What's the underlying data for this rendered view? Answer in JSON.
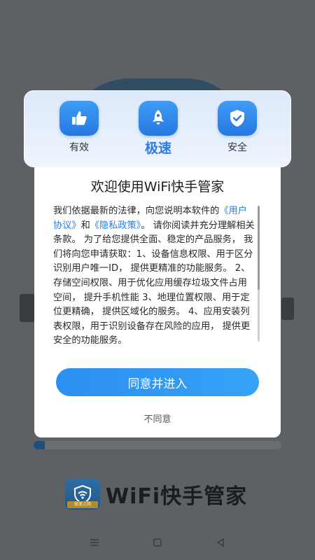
{
  "features": [
    {
      "label": "有效",
      "icon": "thumbs-up-icon"
    },
    {
      "label": "极速",
      "icon": "rocket-icon"
    },
    {
      "label": "安全",
      "icon": "shield-check-icon"
    }
  ],
  "dialog": {
    "title": "欢迎使用WiFi快手管家",
    "intro": "我们依据最新的法律，向您说明本软件的",
    "user_agreement": "《用户协议》",
    "and": "和",
    "privacy_policy": "《隐私政策》",
    "body": "。 请你阅读并充分理解相关条款。 为了给您提供全面、稳定的产品服务， 我们将向您申请获取：1、设备信息权限、用于区分识别用户唯一ID， 提供更精准的功能服务。 2、存储空间权限、用于优化应用缓存垃圾文件占用空间， 提升手机性能 3、地理位置权限、用于定位更精确， 提供区域化的服务。 4、应用安装列表权限，用于识别设备存在风险的应用， 提供更安全的功能服务。",
    "agree_label": "同意并进入",
    "disagree_label": "不同意"
  },
  "brand": {
    "name": "WiFi快手管家",
    "logo_tag": "极速上网"
  },
  "colors": {
    "accent": "#2b7be6",
    "button": "#2a8ff2",
    "overlay": "#5f6367"
  }
}
